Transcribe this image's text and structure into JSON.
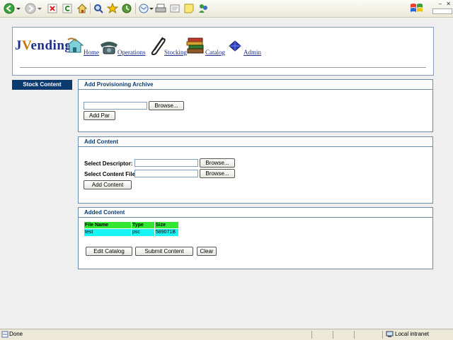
{
  "app": {
    "logo_prefix": "J",
    "logo_accent": "V",
    "logo_suffix": "ending"
  },
  "nav": [
    {
      "id": "home",
      "label": "Home",
      "icon": "house-icon"
    },
    {
      "id": "operations",
      "label": "Operations",
      "icon": "telephone-icon"
    },
    {
      "id": "stocking",
      "label": "Stocking",
      "icon": "paperclip-icon"
    },
    {
      "id": "catalog",
      "label": "Catalog",
      "icon": "books-icon"
    },
    {
      "id": "admin",
      "label": "Admin",
      "icon": "gem-icon"
    }
  ],
  "sidebar": {
    "items": [
      {
        "label": "Stock Content"
      }
    ]
  },
  "provisioning": {
    "title": "Add Provisioning Archive",
    "file_value": "",
    "browse_label": "Browse...",
    "add_label": "Add Par"
  },
  "add_content": {
    "title": "Add Content",
    "descriptor_label": "Select Descriptor:",
    "descriptor_value": "",
    "content_file_label": "Select Content File:",
    "content_file_value": "",
    "browse_label": "Browse...",
    "add_label": "Add Content"
  },
  "added_content": {
    "title": "Added Content",
    "columns": [
      "File Name",
      "Type",
      "Size"
    ],
    "rows": [
      [
        "test",
        "psc",
        "589071B"
      ]
    ],
    "edit_label": "Edit Catalog",
    "submit_label": "Submit Content",
    "clear_label": "Clear"
  },
  "statusbar": {
    "left": "Done",
    "zone": "Local intranet"
  },
  "colors": {
    "brand": "#1c2f8a",
    "sidebar": "#0a3a6e",
    "table_header": "#32e632",
    "table_row": "#19f5f5"
  }
}
